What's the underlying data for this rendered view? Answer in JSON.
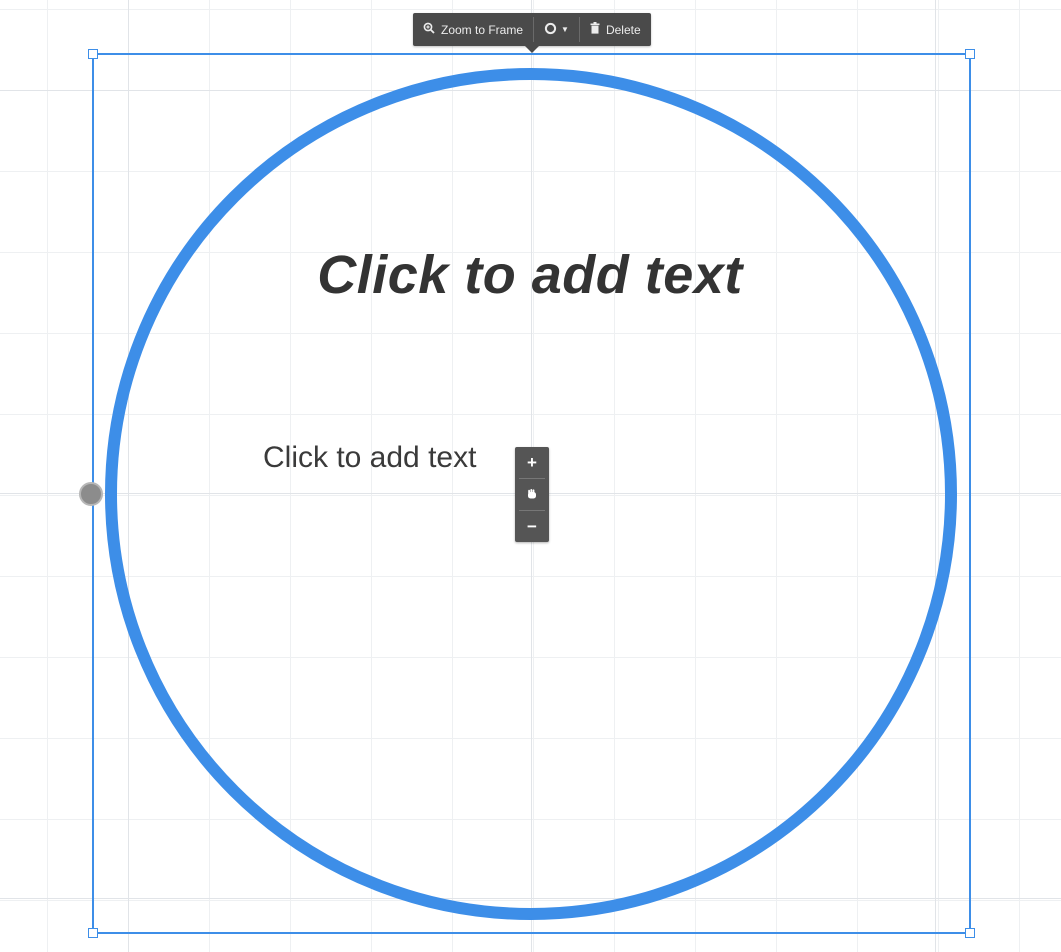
{
  "toolbar": {
    "zoom_to_frame_label": "Zoom to Frame",
    "zoom_icon": "zoom-magnifier-icon",
    "style_icon": "circle-style-icon",
    "dropdown_icon": "caret-down-icon",
    "delete_label": "Delete",
    "delete_icon": "trash-icon"
  },
  "canvas": {
    "title_placeholder": "Click to add text",
    "body_placeholder": "Click to add text"
  },
  "zoom_control": {
    "zoom_in_symbol": "+",
    "zoom_out_symbol": "−",
    "pan_icon": "hand-icon"
  },
  "colors": {
    "selection_accent": "#3d8ee8",
    "circle_stroke": "#3d8ee8",
    "toolbar_background": "#4a4a4a",
    "text": "#333333"
  }
}
